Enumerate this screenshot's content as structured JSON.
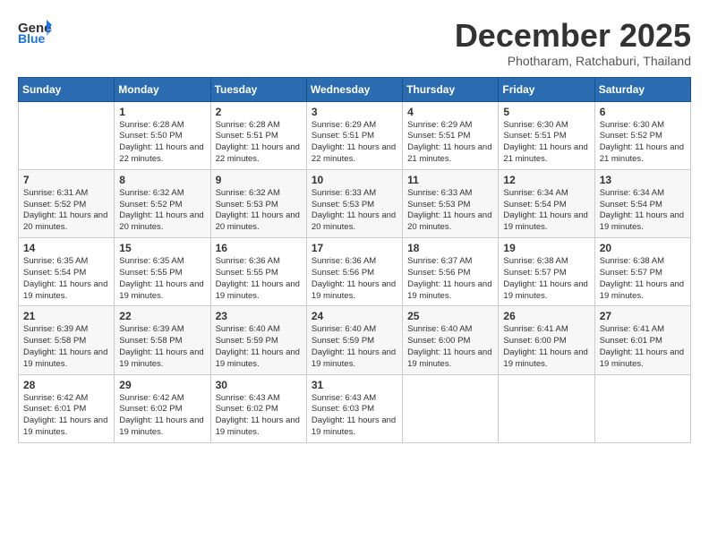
{
  "header": {
    "logo_line1": "General",
    "logo_line2": "Blue",
    "month": "December 2025",
    "location": "Photharam, Ratchaburi, Thailand"
  },
  "days_of_week": [
    "Sunday",
    "Monday",
    "Tuesday",
    "Wednesday",
    "Thursday",
    "Friday",
    "Saturday"
  ],
  "weeks": [
    [
      {
        "day": "",
        "sunrise": "",
        "sunset": "",
        "daylight": ""
      },
      {
        "day": "1",
        "sunrise": "Sunrise: 6:28 AM",
        "sunset": "Sunset: 5:50 PM",
        "daylight": "Daylight: 11 hours and 22 minutes."
      },
      {
        "day": "2",
        "sunrise": "Sunrise: 6:28 AM",
        "sunset": "Sunset: 5:51 PM",
        "daylight": "Daylight: 11 hours and 22 minutes."
      },
      {
        "day": "3",
        "sunrise": "Sunrise: 6:29 AM",
        "sunset": "Sunset: 5:51 PM",
        "daylight": "Daylight: 11 hours and 22 minutes."
      },
      {
        "day": "4",
        "sunrise": "Sunrise: 6:29 AM",
        "sunset": "Sunset: 5:51 PM",
        "daylight": "Daylight: 11 hours and 21 minutes."
      },
      {
        "day": "5",
        "sunrise": "Sunrise: 6:30 AM",
        "sunset": "Sunset: 5:51 PM",
        "daylight": "Daylight: 11 hours and 21 minutes."
      },
      {
        "day": "6",
        "sunrise": "Sunrise: 6:30 AM",
        "sunset": "Sunset: 5:52 PM",
        "daylight": "Daylight: 11 hours and 21 minutes."
      }
    ],
    [
      {
        "day": "7",
        "sunrise": "Sunrise: 6:31 AM",
        "sunset": "Sunset: 5:52 PM",
        "daylight": "Daylight: 11 hours and 20 minutes."
      },
      {
        "day": "8",
        "sunrise": "Sunrise: 6:32 AM",
        "sunset": "Sunset: 5:52 PM",
        "daylight": "Daylight: 11 hours and 20 minutes."
      },
      {
        "day": "9",
        "sunrise": "Sunrise: 6:32 AM",
        "sunset": "Sunset: 5:53 PM",
        "daylight": "Daylight: 11 hours and 20 minutes."
      },
      {
        "day": "10",
        "sunrise": "Sunrise: 6:33 AM",
        "sunset": "Sunset: 5:53 PM",
        "daylight": "Daylight: 11 hours and 20 minutes."
      },
      {
        "day": "11",
        "sunrise": "Sunrise: 6:33 AM",
        "sunset": "Sunset: 5:53 PM",
        "daylight": "Daylight: 11 hours and 20 minutes."
      },
      {
        "day": "12",
        "sunrise": "Sunrise: 6:34 AM",
        "sunset": "Sunset: 5:54 PM",
        "daylight": "Daylight: 11 hours and 19 minutes."
      },
      {
        "day": "13",
        "sunrise": "Sunrise: 6:34 AM",
        "sunset": "Sunset: 5:54 PM",
        "daylight": "Daylight: 11 hours and 19 minutes."
      }
    ],
    [
      {
        "day": "14",
        "sunrise": "Sunrise: 6:35 AM",
        "sunset": "Sunset: 5:54 PM",
        "daylight": "Daylight: 11 hours and 19 minutes."
      },
      {
        "day": "15",
        "sunrise": "Sunrise: 6:35 AM",
        "sunset": "Sunset: 5:55 PM",
        "daylight": "Daylight: 11 hours and 19 minutes."
      },
      {
        "day": "16",
        "sunrise": "Sunrise: 6:36 AM",
        "sunset": "Sunset: 5:55 PM",
        "daylight": "Daylight: 11 hours and 19 minutes."
      },
      {
        "day": "17",
        "sunrise": "Sunrise: 6:36 AM",
        "sunset": "Sunset: 5:56 PM",
        "daylight": "Daylight: 11 hours and 19 minutes."
      },
      {
        "day": "18",
        "sunrise": "Sunrise: 6:37 AM",
        "sunset": "Sunset: 5:56 PM",
        "daylight": "Daylight: 11 hours and 19 minutes."
      },
      {
        "day": "19",
        "sunrise": "Sunrise: 6:38 AM",
        "sunset": "Sunset: 5:57 PM",
        "daylight": "Daylight: 11 hours and 19 minutes."
      },
      {
        "day": "20",
        "sunrise": "Sunrise: 6:38 AM",
        "sunset": "Sunset: 5:57 PM",
        "daylight": "Daylight: 11 hours and 19 minutes."
      }
    ],
    [
      {
        "day": "21",
        "sunrise": "Sunrise: 6:39 AM",
        "sunset": "Sunset: 5:58 PM",
        "daylight": "Daylight: 11 hours and 19 minutes."
      },
      {
        "day": "22",
        "sunrise": "Sunrise: 6:39 AM",
        "sunset": "Sunset: 5:58 PM",
        "daylight": "Daylight: 11 hours and 19 minutes."
      },
      {
        "day": "23",
        "sunrise": "Sunrise: 6:40 AM",
        "sunset": "Sunset: 5:59 PM",
        "daylight": "Daylight: 11 hours and 19 minutes."
      },
      {
        "day": "24",
        "sunrise": "Sunrise: 6:40 AM",
        "sunset": "Sunset: 5:59 PM",
        "daylight": "Daylight: 11 hours and 19 minutes."
      },
      {
        "day": "25",
        "sunrise": "Sunrise: 6:40 AM",
        "sunset": "Sunset: 6:00 PM",
        "daylight": "Daylight: 11 hours and 19 minutes."
      },
      {
        "day": "26",
        "sunrise": "Sunrise: 6:41 AM",
        "sunset": "Sunset: 6:00 PM",
        "daylight": "Daylight: 11 hours and 19 minutes."
      },
      {
        "day": "27",
        "sunrise": "Sunrise: 6:41 AM",
        "sunset": "Sunset: 6:01 PM",
        "daylight": "Daylight: 11 hours and 19 minutes."
      }
    ],
    [
      {
        "day": "28",
        "sunrise": "Sunrise: 6:42 AM",
        "sunset": "Sunset: 6:01 PM",
        "daylight": "Daylight: 11 hours and 19 minutes."
      },
      {
        "day": "29",
        "sunrise": "Sunrise: 6:42 AM",
        "sunset": "Sunset: 6:02 PM",
        "daylight": "Daylight: 11 hours and 19 minutes."
      },
      {
        "day": "30",
        "sunrise": "Sunrise: 6:43 AM",
        "sunset": "Sunset: 6:02 PM",
        "daylight": "Daylight: 11 hours and 19 minutes."
      },
      {
        "day": "31",
        "sunrise": "Sunrise: 6:43 AM",
        "sunset": "Sunset: 6:03 PM",
        "daylight": "Daylight: 11 hours and 19 minutes."
      },
      {
        "day": "",
        "sunrise": "",
        "sunset": "",
        "daylight": ""
      },
      {
        "day": "",
        "sunrise": "",
        "sunset": "",
        "daylight": ""
      },
      {
        "day": "",
        "sunrise": "",
        "sunset": "",
        "daylight": ""
      }
    ]
  ]
}
